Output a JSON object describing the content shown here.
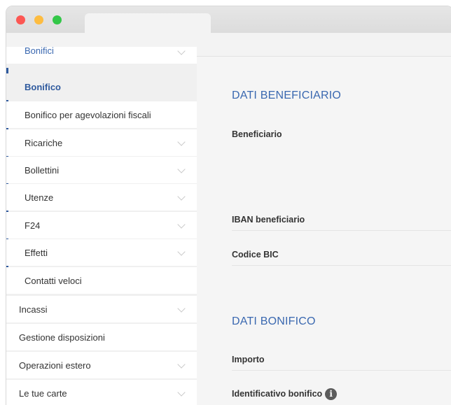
{
  "sidebar": {
    "cut_item": "Bonifici",
    "sub_items": [
      {
        "label": "Bonifico",
        "active": true
      },
      {
        "label": "Bonifico per agevolazioni fiscali"
      },
      {
        "label": "Ricariche"
      },
      {
        "label": "Bollettini"
      },
      {
        "label": "Utenze"
      },
      {
        "label": "F24"
      },
      {
        "label": "Effetti"
      },
      {
        "label": "Contatti veloci"
      }
    ],
    "top_items": [
      {
        "label": "Incassi"
      },
      {
        "label": "Gestione disposizioni"
      },
      {
        "label": "Operazioni estero"
      },
      {
        "label": "Le tue carte"
      }
    ]
  },
  "main": {
    "beneficiario_section": {
      "title": "DATI BENEFICIARIO",
      "fields": [
        "Beneficiario",
        "IBAN beneficiario",
        "Codice BIC"
      ]
    },
    "bonifico_section": {
      "title": "DATI BONIFICO",
      "fields": [
        "Importo",
        "Identificativo bonifico"
      ]
    }
  },
  "colors": {
    "accent": "#2f5a9e",
    "section_title": "#3a68b0"
  }
}
